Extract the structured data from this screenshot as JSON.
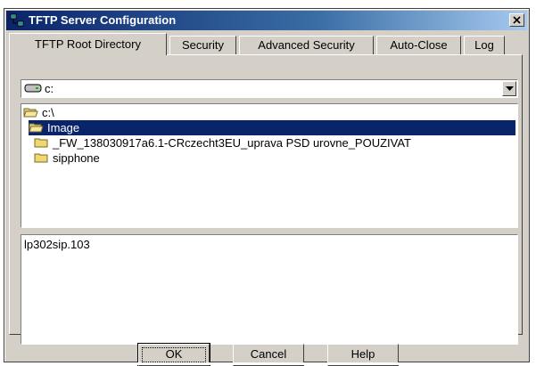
{
  "window": {
    "title": "TFTP Server Configuration"
  },
  "tabs": [
    {
      "label": "TFTP Root Directory",
      "active": true
    },
    {
      "label": "Security",
      "active": false
    },
    {
      "label": "Advanced Security",
      "active": false
    },
    {
      "label": "Auto-Close",
      "active": false
    },
    {
      "label": "Log",
      "active": false
    }
  ],
  "drive": {
    "selected": "c:"
  },
  "directories": [
    {
      "label": "c:\\",
      "icon": "open-folder-icon",
      "selected": false
    },
    {
      "label": "Image",
      "icon": "open-folder-icon",
      "selected": true
    },
    {
      "label": "_FW_138030917a6.1-CRczecht3EU_uprava PSD urovne_POUZIVAT",
      "icon": "folder-icon",
      "selected": false
    },
    {
      "label": "sipphone",
      "icon": "folder-icon",
      "selected": false
    }
  ],
  "files": [
    {
      "label": "lp302sip.103"
    }
  ],
  "buttons": {
    "ok": "OK",
    "cancel": "Cancel",
    "help": "Help"
  },
  "colors": {
    "titlebar_start": "#0a246a",
    "selection": "#0a246a",
    "face": "#d4d0c8"
  }
}
